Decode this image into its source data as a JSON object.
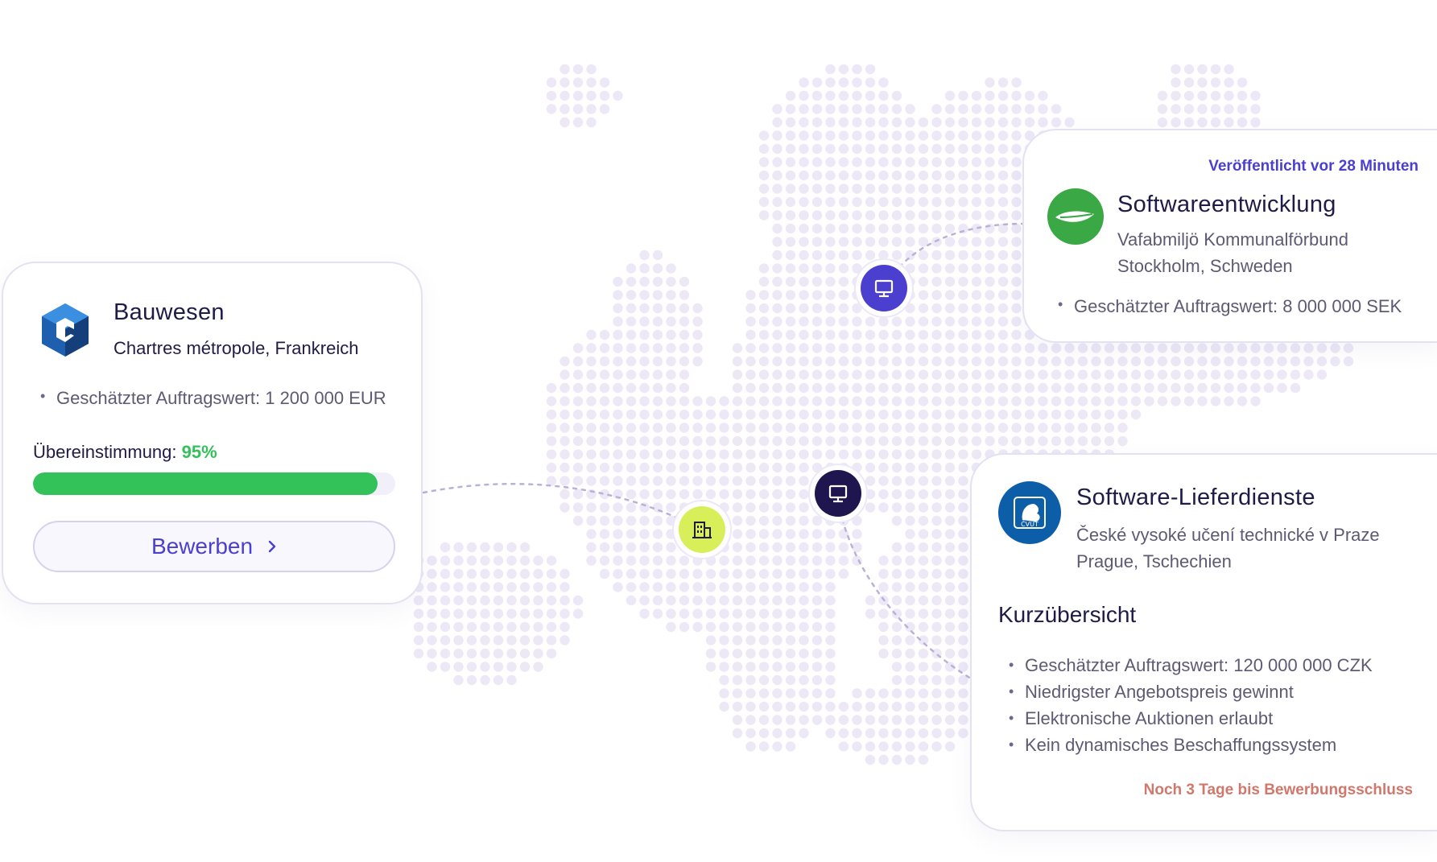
{
  "colors": {
    "accent": "#4b3fcf",
    "match_green": "#33c15a",
    "deadline": "#d0786b",
    "map_dot": "#ece8f6",
    "pin_blue": "#4b3fcf",
    "pin_dark": "#1f1650",
    "pin_lime": "#d8ef5a"
  },
  "map": {
    "pins": [
      {
        "icon": "monitor-icon"
      },
      {
        "icon": "monitor-icon"
      },
      {
        "icon": "building-icon"
      }
    ]
  },
  "cards": {
    "bauwesen": {
      "logo_icon": "cube-logo-icon",
      "title": "Bauwesen",
      "location": "Chartres métropole, Frankreich",
      "bullets": [
        "Geschätzter Auftragswert: 1 200 000 EUR"
      ],
      "match_label": "Übereinstimmung:",
      "match_value": "95%",
      "match_fraction": 0.95,
      "apply_label": "Bewerben",
      "apply_icon": "chevron-right-icon"
    },
    "software": {
      "published": "Veröffentlicht vor 28 Minuten",
      "logo_icon": "leaf-logo-icon",
      "title": "Softwareentwicklung",
      "buyer": "Vafabmiljö Kommunalförbund",
      "location": "Stockholm, Schweden",
      "bullets": [
        "Geschätzter Auftragswert: 8 000 000 SEK"
      ]
    },
    "software_delivery": {
      "logo_icon": "lion-emblem-logo-icon",
      "title": "Software-Lieferdienste",
      "buyer": "České vysoké učení technické v Praze",
      "location": "Prague, Tschechien",
      "section_title": "Kurzübersicht",
      "bullets": [
        "Geschätzter Auftragswert: 120 000 000 CZK",
        "Niedrigster Angebotspreis gewinnt",
        "Elektronische Auktionen erlaubt",
        "Kein dynamisches Beschaffungssystem"
      ],
      "deadline": "Noch 3 Tage bis Bewerbungsschluss"
    }
  }
}
